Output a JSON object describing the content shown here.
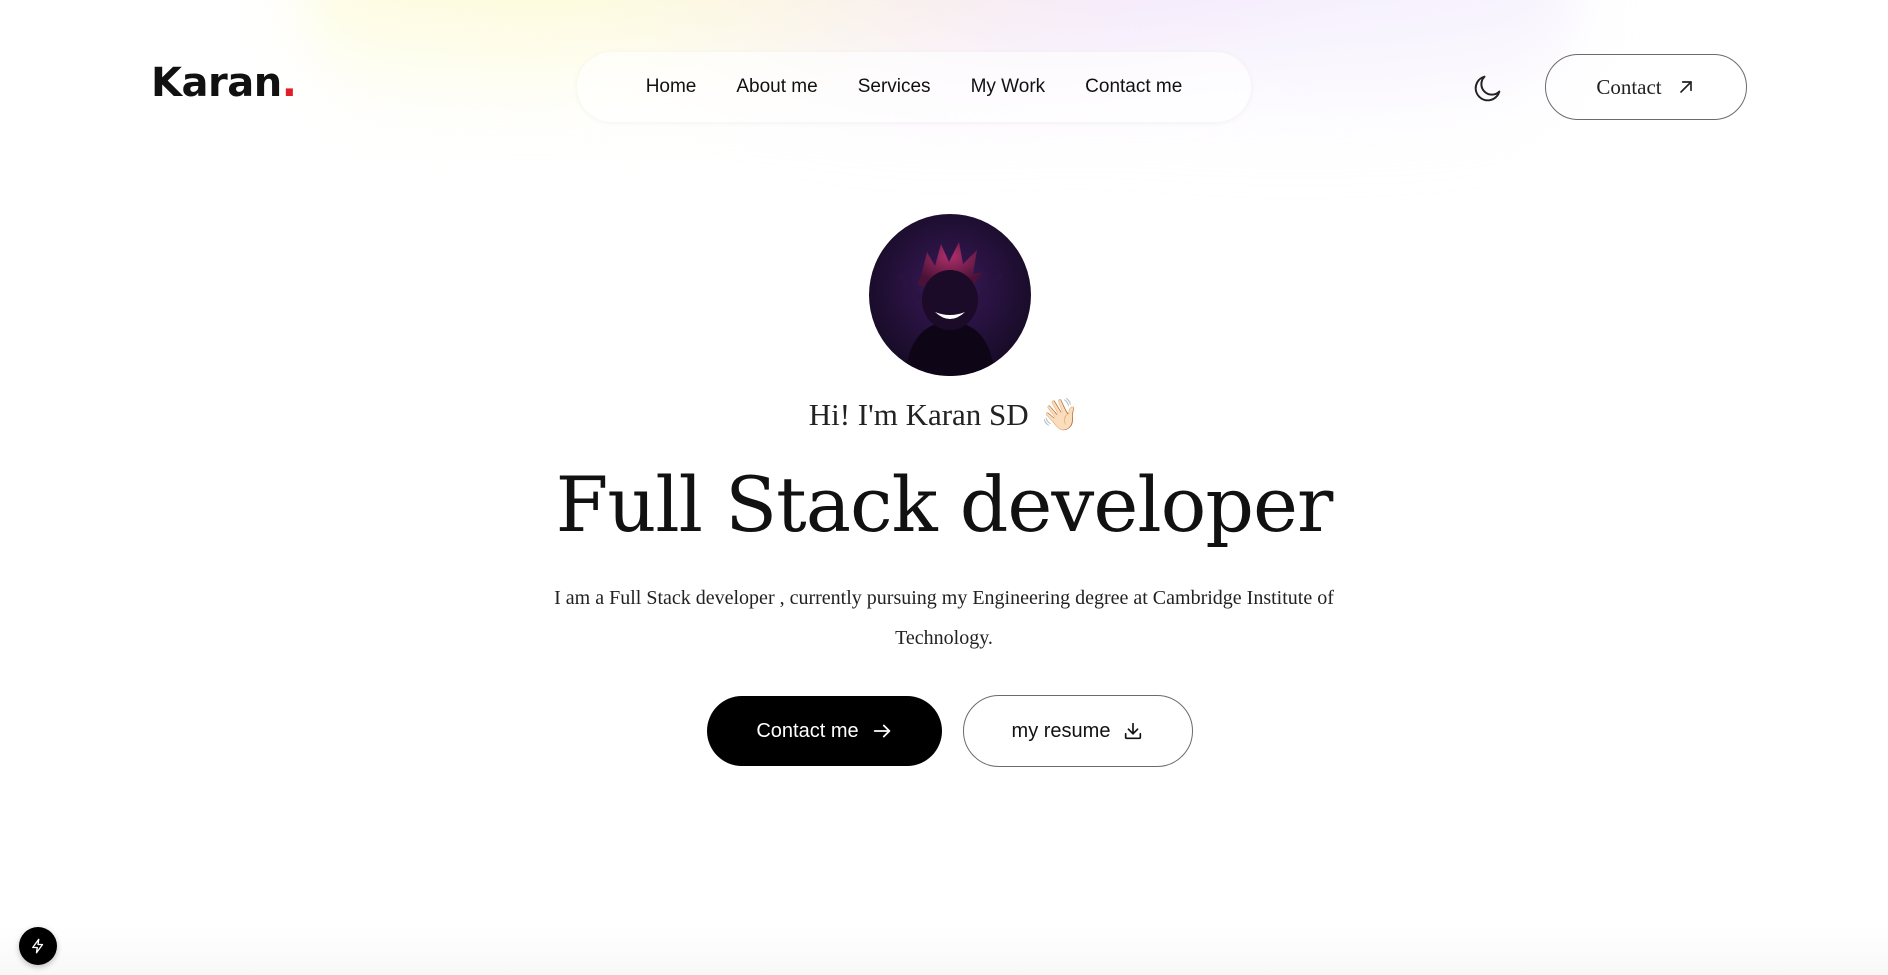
{
  "brand": {
    "name": "Karan",
    "dot": ".",
    "dot_color": "#e11d2a"
  },
  "nav": {
    "items": [
      {
        "label": "Home"
      },
      {
        "label": "About me"
      },
      {
        "label": "Services"
      },
      {
        "label": "My Work"
      },
      {
        "label": "Contact me"
      }
    ]
  },
  "header": {
    "theme_icon": "moon-icon",
    "contact_label": "Contact",
    "contact_icon": "arrow-up-right-icon"
  },
  "hero": {
    "avatar_icon": "avatar-image",
    "greeting": "Hi! I'm Karan SD",
    "greeting_emoji": "👋🏻",
    "title": "Full Stack developer",
    "description": "I am a Full Stack developer , currently pursuing my Engineering degree at Cambridge Institute of Technology.",
    "primary_button": "Contact me",
    "primary_icon": "arrow-right-icon",
    "secondary_button": "my resume",
    "secondary_icon": "download-icon"
  },
  "dev_badge": {
    "icon": "lightning-icon"
  },
  "colors": {
    "accent": "#e11d2a",
    "primary_button_bg": "#000000",
    "avatar_bg": "#1d0d2e"
  }
}
